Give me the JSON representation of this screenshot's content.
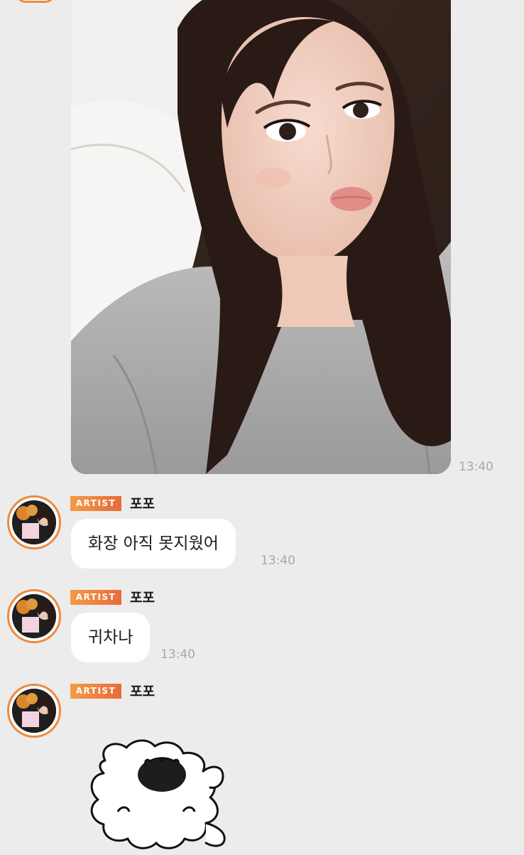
{
  "messages": [
    {
      "type": "photo",
      "time": "13:40"
    },
    {
      "type": "text",
      "sender_badge": "ARTIST",
      "sender_name": "포포",
      "text": "화장 아직 못지웠어",
      "time": "13:40"
    },
    {
      "type": "text",
      "sender_badge": "ARTIST",
      "sender_name": "포포",
      "text": "귀차나",
      "time": "13:40"
    },
    {
      "type": "sticker",
      "sender_badge": "ARTIST",
      "sender_name": "포포"
    }
  ],
  "colors": {
    "background": "#ececec",
    "accent": "#ef8a3d",
    "bubble": "#ffffff",
    "timestamp": "#a7a7a7"
  },
  "icons": {
    "sticker": "sleeping-cat-sticker"
  }
}
